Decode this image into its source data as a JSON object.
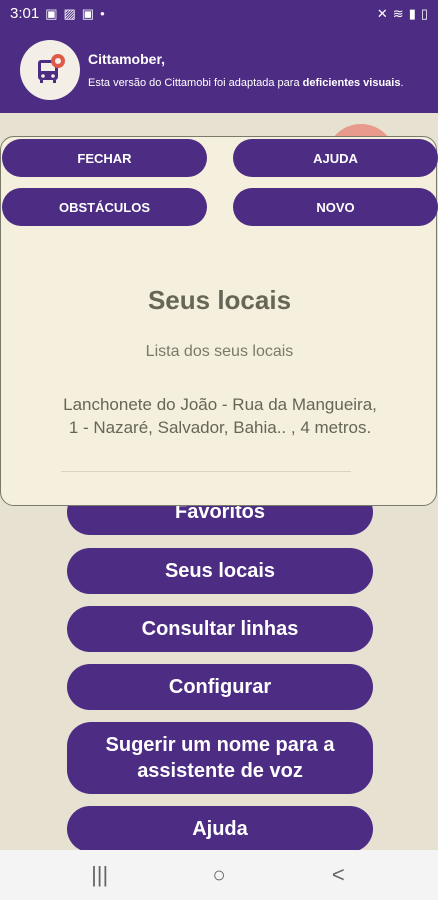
{
  "status_bar": {
    "time": "3:01",
    "left_icons": [
      "gallery-icon",
      "image-icon",
      "gallery-icon",
      "dot-icon"
    ],
    "right_icons": [
      "mute-icon",
      "wifi-icon",
      "signal-icon",
      "battery-icon"
    ]
  },
  "banner": {
    "title": "Cittamober,",
    "message_part1": "Esta versão do Cittamobi foi adaptada para ",
    "message_bold": "deficientes visuais",
    "message_end": "."
  },
  "modal": {
    "buttons": [
      "FECHAR",
      "AJUDA",
      "OBSTÁCULOS",
      "NOVO"
    ],
    "title": "Seus locais",
    "subtitle": "Lista dos seus locais",
    "items": [
      "Lanchonete do João - Rua da Mangueira, 1 - Nazaré, Salvador, Bahia.. , 4 metros."
    ]
  },
  "menu": {
    "items": [
      "Favoritos",
      "Seus locais",
      "Consultar linhas",
      "Configurar",
      "Sugerir um nome para a assistente de voz",
      "Ajuda"
    ]
  },
  "nav": {
    "recent": "|||",
    "home": "○",
    "back": "<"
  },
  "colors": {
    "primary": "#4d2c84",
    "background": "#e6e1d0",
    "modal_bg": "#f5f0dd",
    "accent": "#e98a7a"
  }
}
